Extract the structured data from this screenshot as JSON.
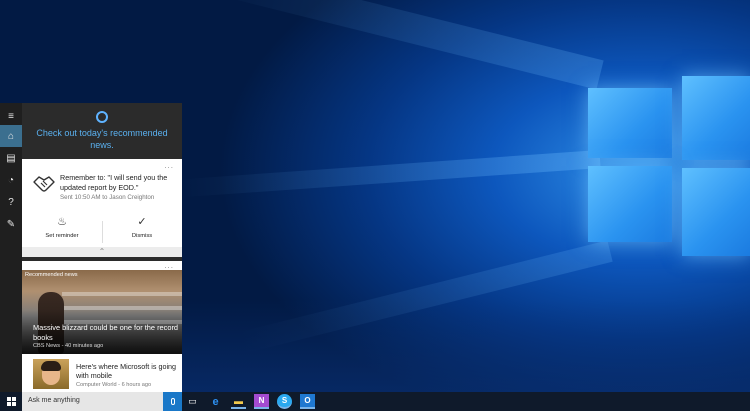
{
  "sidebar": {
    "items": [
      {
        "icon": "hamburger-icon",
        "glyph": "≡"
      },
      {
        "icon": "home-icon",
        "glyph": "⌂"
      },
      {
        "icon": "notebook-icon",
        "glyph": "▤"
      },
      {
        "icon": "reminders-icon",
        "glyph": "◔"
      },
      {
        "icon": "help-icon",
        "glyph": "?"
      },
      {
        "icon": "feedback-icon",
        "glyph": "✎"
      }
    ]
  },
  "header": {
    "message": "Check out today's recommended news."
  },
  "reminder_card": {
    "more": "...",
    "title": "Remember to: \"I will send you the updated report by EOD.\"",
    "subtitle": "Sent 10:50 AM to Jason Creighton",
    "actions": [
      {
        "label": "Set reminder",
        "icon": "lightbulb-icon",
        "glyph": "♨"
      },
      {
        "label": "Dismiss",
        "icon": "checkmark-icon",
        "glyph": "✓"
      }
    ],
    "collapse_glyph": "⌃"
  },
  "news_card": {
    "more": "...",
    "section_label": "Recommended news",
    "hero": {
      "title": "Massive blizzard could be one for the record books",
      "source": "CBS News - 40 minutes ago"
    },
    "items": [
      {
        "title": "Here's where Microsoft is going with mobile",
        "source": "Computer World - 6 hours ago"
      }
    ]
  },
  "taskbar": {
    "search_placeholder": "Ask me anything",
    "icons": [
      {
        "name": "task-view-icon",
        "glyph": "▭",
        "color": "#ffffff"
      },
      {
        "name": "edge-icon",
        "glyph": "e",
        "color": "#2d8ff0"
      },
      {
        "name": "file-explorer-icon",
        "glyph": "▬",
        "color": "#f2c94c"
      },
      {
        "name": "onenote-icon",
        "glyph": "N",
        "color": "#a34bd0"
      },
      {
        "name": "skype-icon",
        "glyph": "S",
        "color": "#2aa8f0"
      },
      {
        "name": "outlook-icon",
        "glyph": "O",
        "color": "#1f78d1"
      }
    ]
  },
  "colors": {
    "accent": "#5ab0ef",
    "panel_bg": "#2b2b2b",
    "rail_active": "#3b6f8f",
    "mic_blue": "#1a78c8"
  }
}
